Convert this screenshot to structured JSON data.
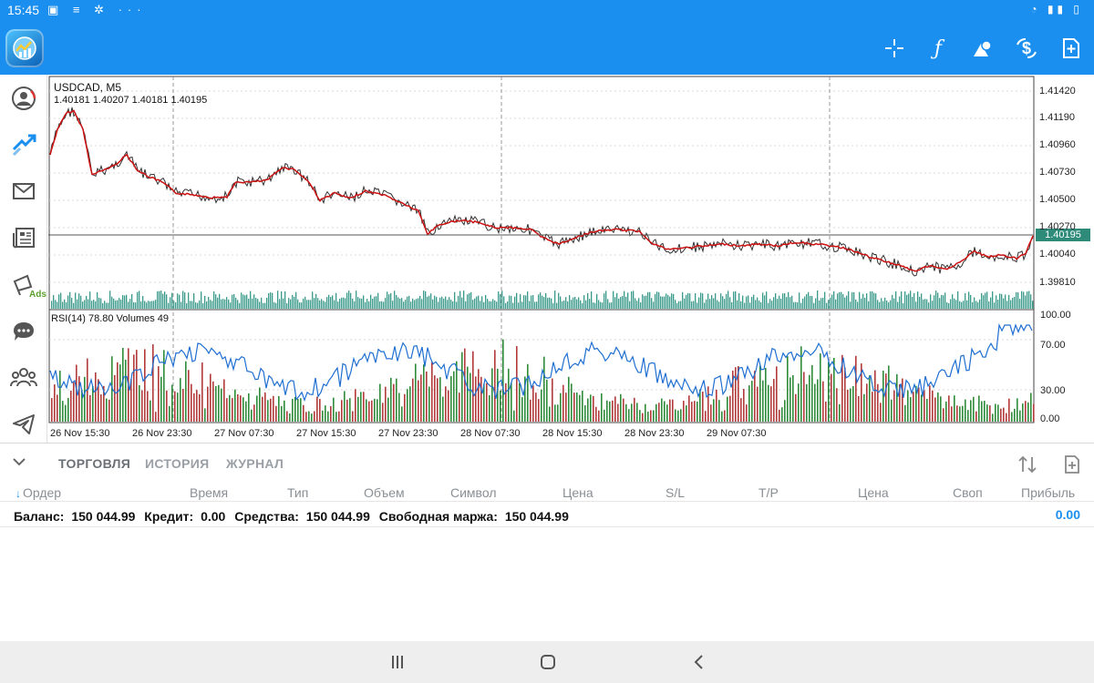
{
  "status_bar": {
    "time": "15:45",
    "left_icons": "▣ ≡ ✲ ···",
    "right_icons": "◔ ▮▮ ▯"
  },
  "app_bar": {
    "logo_icon": "metatrader-logo-icon",
    "tools": [
      "crosshair-icon",
      "function-icon",
      "shapes-icon",
      "dollar-exchange-icon",
      "new-order-icon"
    ]
  },
  "side_nav": {
    "items": [
      "account-icon",
      "trade-icon",
      "mail-icon",
      "news-icon",
      "ads-icon",
      "chat-icon",
      "community-icon",
      "telegram-icon"
    ],
    "ads_label": "Ads"
  },
  "chart": {
    "symbol": "USDCAD, M5",
    "ohlc": "1.40181 1.40207 1.40181 1.40195",
    "current_price": "1.40195",
    "price_axis": [
      "1.41420",
      "1.41190",
      "1.40960",
      "1.40730",
      "1.40500",
      "1.40270",
      "1.40040",
      "1.39810"
    ],
    "rsi_label": "RSI(14) 78.80 Volumes 49",
    "rsi_axis": [
      "100.00",
      "70.00",
      "30.00",
      "0.00"
    ],
    "time_axis": [
      "26 Nov 15:30",
      "26 Nov 23:30",
      "27 Nov 07:30",
      "27 Nov 15:30",
      "27 Nov 23:30",
      "28 Nov 07:30",
      "28 Nov 15:30",
      "28 Nov 23:30",
      "29 Nov 07:30"
    ],
    "colors": {
      "ma_line": "#cc1111",
      "price_line": "#333333",
      "volume": "#3a9a8a",
      "rsi": "#1f6fd1",
      "vol_up": "#2e8b3a",
      "vol_down": "#b23a3a",
      "price_tag": "#2e8b7a"
    }
  },
  "panel": {
    "tabs": [
      "ТОРГОВЛЯ",
      "ИСТОРИЯ",
      "ЖУРНАЛ"
    ],
    "columns": [
      "Ордер",
      "Время",
      "Тип",
      "Объем",
      "Символ",
      "Цена",
      "S/L",
      "T/P",
      "Цена",
      "Своп",
      "Прибыль"
    ],
    "summary": {
      "balance_label": "Баланс:",
      "balance": "150 044.99",
      "credit_label": "Кредит:",
      "credit": "0.00",
      "equity_label": "Средства:",
      "equity": "150 044.99",
      "free_margin_label": "Свободная маржа:",
      "free_margin": "150 044.99",
      "profit": "0.00"
    }
  },
  "system_nav": [
    "recents-icon",
    "home-icon",
    "back-icon"
  ]
}
